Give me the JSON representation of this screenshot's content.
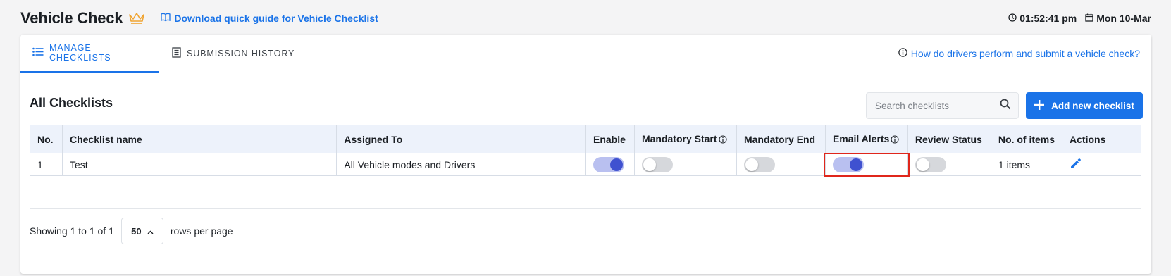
{
  "header": {
    "title": "Vehicle Check",
    "guide_link": "Download quick guide for Vehicle Checklist",
    "time": "01:52:41 pm",
    "date": "Mon 10-Mar"
  },
  "tabs": [
    {
      "label": "MANAGE CHECKLISTS",
      "active": true
    },
    {
      "label": "SUBMISSION HISTORY",
      "active": false
    }
  ],
  "help_link": "How do drivers perform and submit a vehicle check?",
  "section": {
    "title": "All Checklists",
    "search_placeholder": "Search checklists",
    "add_button": "Add new checklist"
  },
  "table": {
    "columns": [
      "No.",
      "Checklist name",
      "Assigned To",
      "Enable",
      "Mandatory Start",
      "Mandatory End",
      "Email Alerts",
      "Review Status",
      "No. of items",
      "Actions"
    ],
    "rows": [
      {
        "no": "1",
        "name": "Test",
        "assigned_to": "All Vehicle modes and Drivers",
        "enable": true,
        "mandatory_start": false,
        "mandatory_end": false,
        "email_alerts": true,
        "review_status": false,
        "items": "1 items"
      }
    ]
  },
  "pagination": {
    "showing": "Showing 1 to 1 of 1",
    "rows_per_page": "50",
    "rows_per_page_label": "rows per page"
  },
  "colors": {
    "accent": "#1a73e8",
    "toggle_on": "#3f51d0",
    "highlight": "#e0261b",
    "crown": "#f0a431"
  }
}
